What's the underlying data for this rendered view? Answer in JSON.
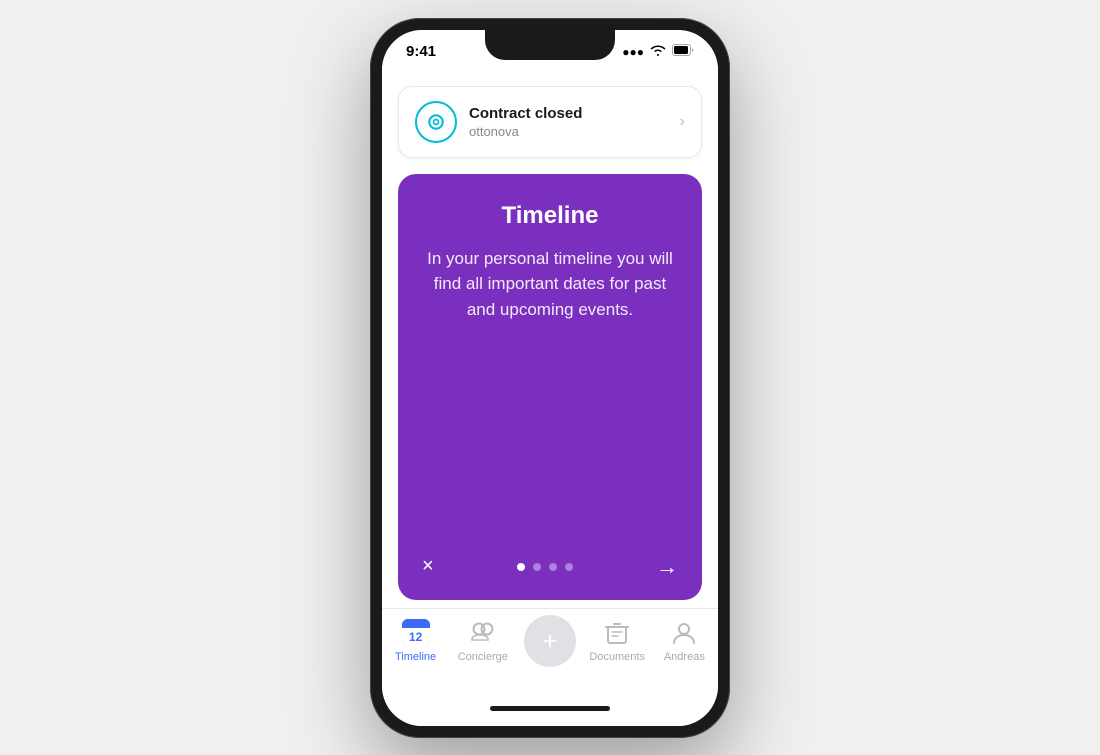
{
  "phone": {
    "statusBar": {
      "time": "9:41",
      "signalBars": "▐▐▐",
      "wifi": "WiFi",
      "battery": "🔋"
    },
    "notificationCard": {
      "title": "Contract closed",
      "subtitle": "ottonova",
      "chevron": "›"
    },
    "timelineCard": {
      "title": "Timeline",
      "description": "In your personal timeline you will find all important dates for past and upcoming events.",
      "dots": [
        {
          "active": true
        },
        {
          "active": false
        },
        {
          "active": false
        },
        {
          "active": false
        }
      ],
      "closeLabel": "×",
      "nextLabel": "→"
    },
    "bottomNav": {
      "items": [
        {
          "id": "timeline",
          "label": "Timeline",
          "active": true,
          "calNum": "12"
        },
        {
          "id": "concierge",
          "label": "Concierge",
          "active": false
        },
        {
          "id": "add",
          "label": "",
          "active": false
        },
        {
          "id": "documents",
          "label": "Documents",
          "active": false
        },
        {
          "id": "andreas",
          "label": "Andreas",
          "active": false
        }
      ]
    }
  }
}
